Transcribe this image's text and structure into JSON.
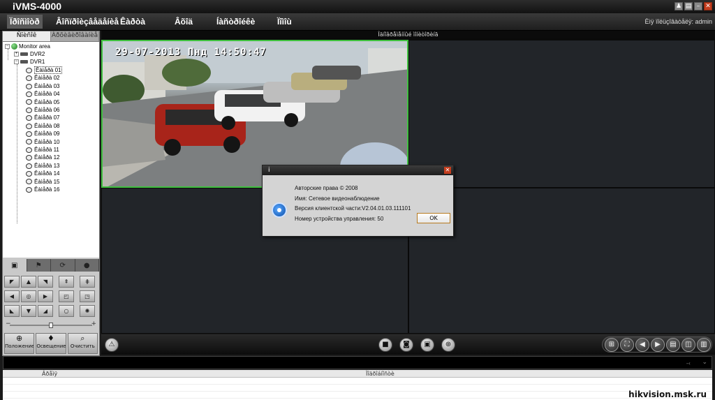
{
  "app": {
    "title": "iVMS-4000",
    "login_info": "Èìÿ ïîëüçîâàòåëÿ: admin"
  },
  "menu": {
    "items": [
      {
        "label": "Ïðîñìîòð"
      },
      {
        "label": "Âîñïðîèçâåäåíèå"
      },
      {
        "label": "Êàðòà"
      },
      {
        "label": "Âõîä"
      },
      {
        "label": "Íàñòðîéêè"
      },
      {
        "label": "Ïîìîù"
      }
    ]
  },
  "left_panel": {
    "tabs": [
      {
        "label": "Ñïèñîê"
      },
      {
        "label": "Àðõèâèðîâàíèå"
      }
    ],
    "tree": {
      "root": "Monitor area",
      "dvr2": "DVR2",
      "dvr1": "DVR1",
      "cameras": [
        "Êàìåðà 01",
        "Êàìåðà 02",
        "Êàìåðà 03",
        "Êàìåðà 04",
        "Êàìåðà 05",
        "Êàìåðà 06",
        "Êàìåðà 07",
        "Êàìåðà 08",
        "Êàìåðà 09",
        "Êàìåðà 10",
        "Êàìåðà 11",
        "Êàìåðà 12",
        "Êàìåðà 13",
        "Êàìåðà 14",
        "Êàìåðà 15",
        "Êàìåðà 16"
      ],
      "selected_index": 0
    },
    "ptz": {
      "zoom_level": 0.5,
      "bottom_buttons": [
        {
          "label": "Положение",
          "icon": "zoom-icon"
        },
        {
          "label": "Освещение",
          "icon": "light-icon"
        },
        {
          "label": "Очистить",
          "icon": "wiper-icon"
        }
      ]
    }
  },
  "video": {
    "header": "Îäíîâðåìåííûé ìîíèòîðèíã",
    "osd_text": "29-07-2013 Пнд 14:50:47"
  },
  "dialog": {
    "title": "i",
    "lines": [
      "Авторские права © 2008",
      "Имя: Сетевое видеонаблюдение",
      "Версия клиентской части:V2.04.01.03.111101",
      "Номер устройства управления: 50"
    ],
    "ok_label": "OK"
  },
  "log": {
    "columns": [
      "Âðåìÿ",
      "Ïîäðîáíîñòè"
    ]
  },
  "watermark": "hikvision.msk.ru"
}
